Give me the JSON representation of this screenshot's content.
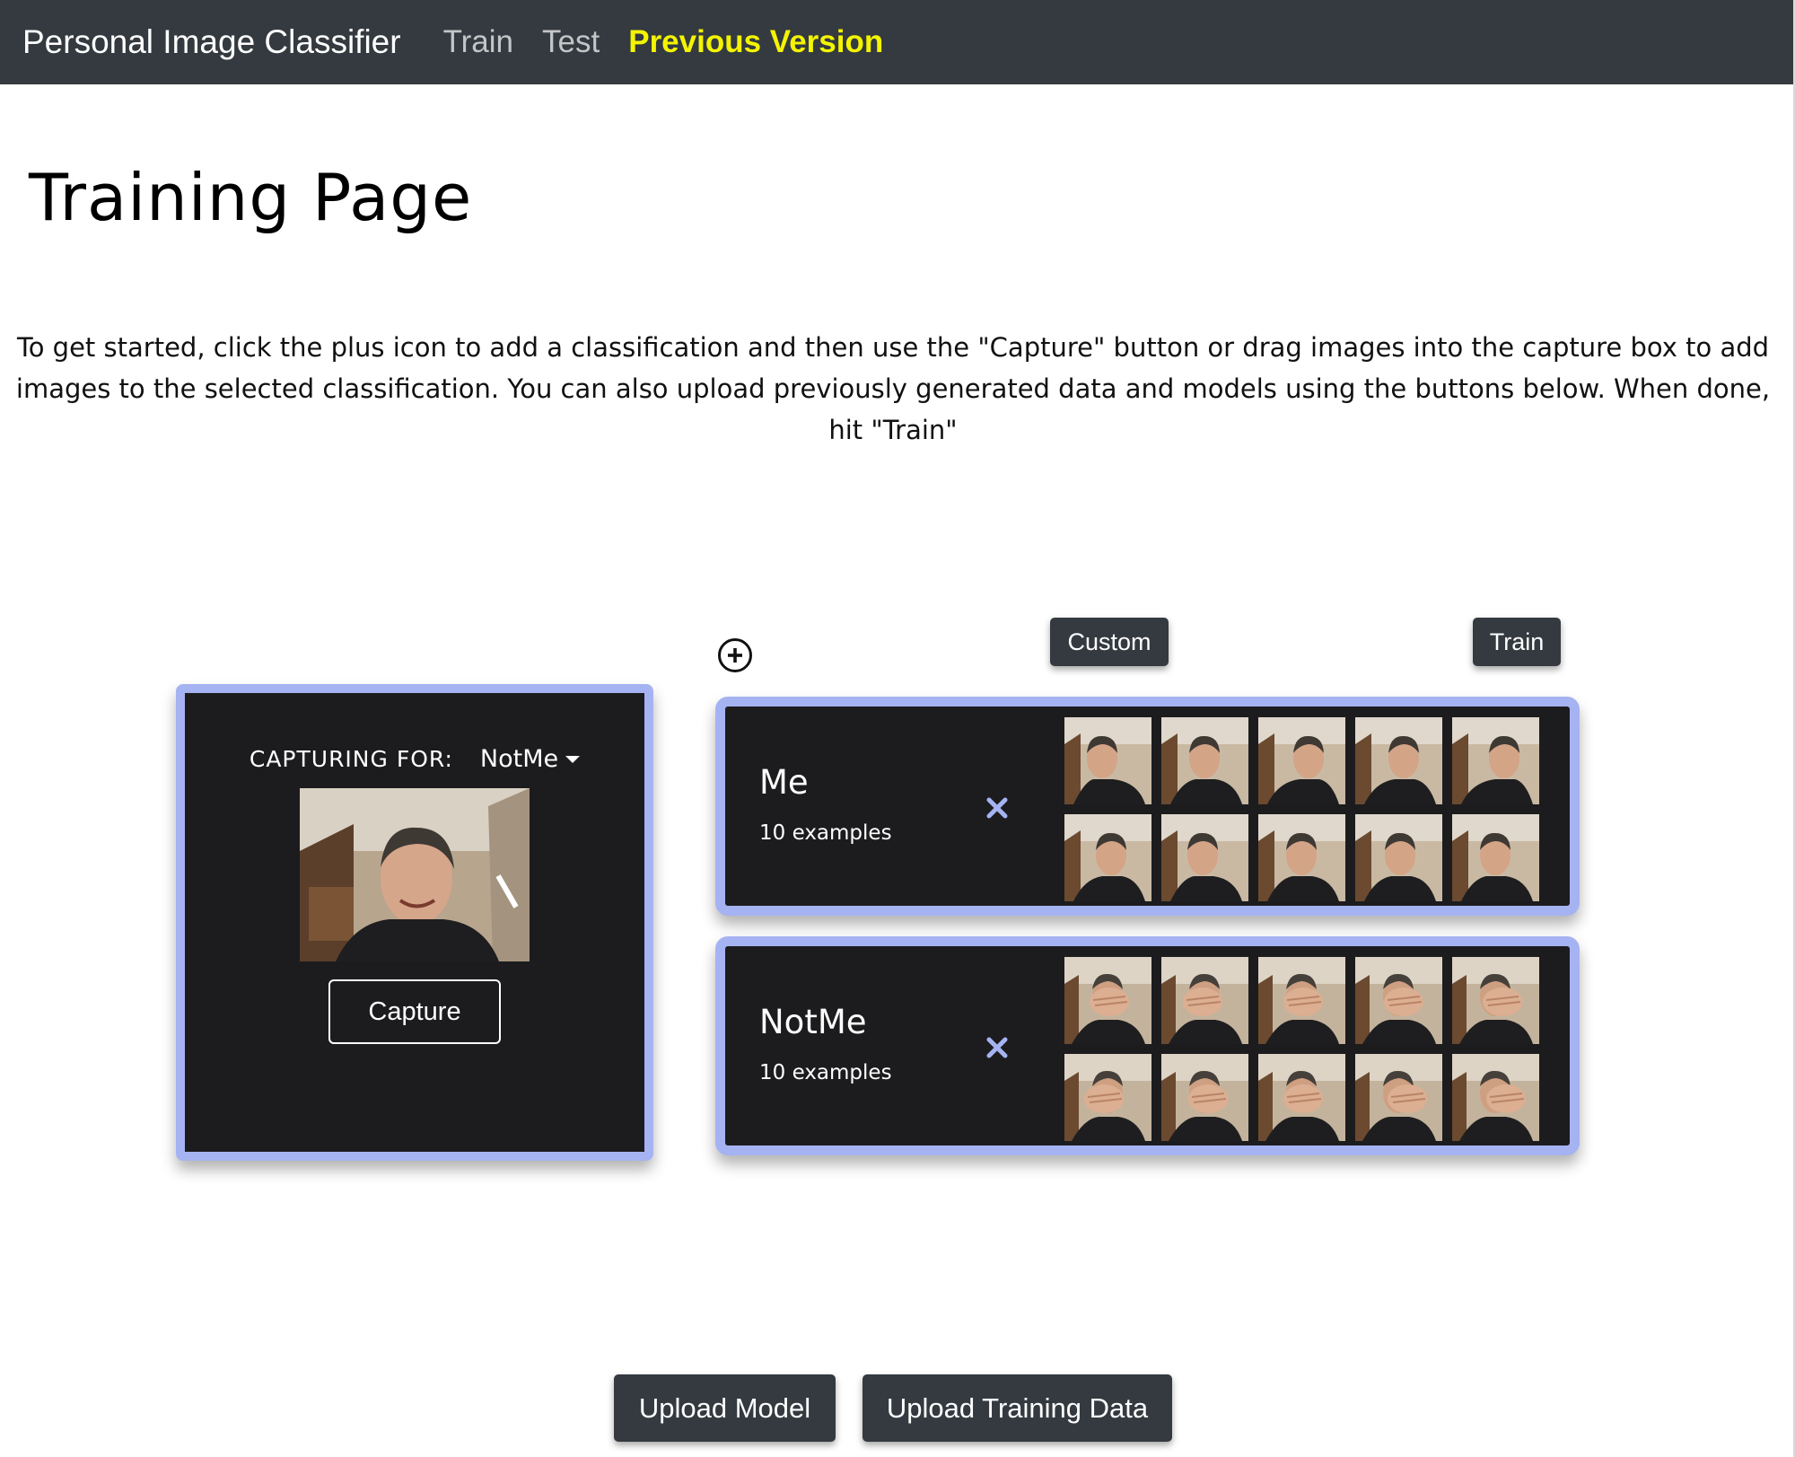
{
  "navbar": {
    "brand": "Personal Image Classifier",
    "links": [
      {
        "label": "Train"
      },
      {
        "label": "Test"
      },
      {
        "label": "Previous Version",
        "color": "#f4f400"
      }
    ],
    "background": "#343a40"
  },
  "page": {
    "title": "Training Page",
    "intro": "To get started, click the plus icon to add a classification and then use the \"Capture\" button or drag images into the capture box to add images to the selected classification. You can also upload previously generated data and models using the buttons below. When done, hit \"Train\""
  },
  "toolbar": {
    "add_icon": "plus-circle-icon",
    "custom_label": "Custom",
    "train_label": "Train"
  },
  "capture": {
    "label": "CAPTURING FOR:",
    "selected_class": "NotMe",
    "button_label": "Capture",
    "accent_color": "#a6b3f2"
  },
  "classes": [
    {
      "name": "Me",
      "count_label": "10 examples",
      "remove_icon": "close-icon",
      "thumbnails": [
        "face-photo",
        "face-photo",
        "face-photo",
        "face-photo",
        "face-photo",
        "face-photo",
        "face-photo",
        "face-photo",
        "face-photo",
        "face-photo"
      ]
    },
    {
      "name": "NotMe",
      "count_label": "10 examples",
      "remove_icon": "close-icon",
      "thumbnails": [
        "covered-face-photo",
        "covered-face-photo",
        "covered-face-photo",
        "covered-face-photo",
        "covered-face-photo",
        "covered-face-photo",
        "covered-face-photo",
        "covered-face-photo",
        "covered-face-photo",
        "covered-face-photo"
      ]
    }
  ],
  "footer": {
    "upload_model_label": "Upload Model",
    "upload_data_label": "Upload Training Data"
  }
}
